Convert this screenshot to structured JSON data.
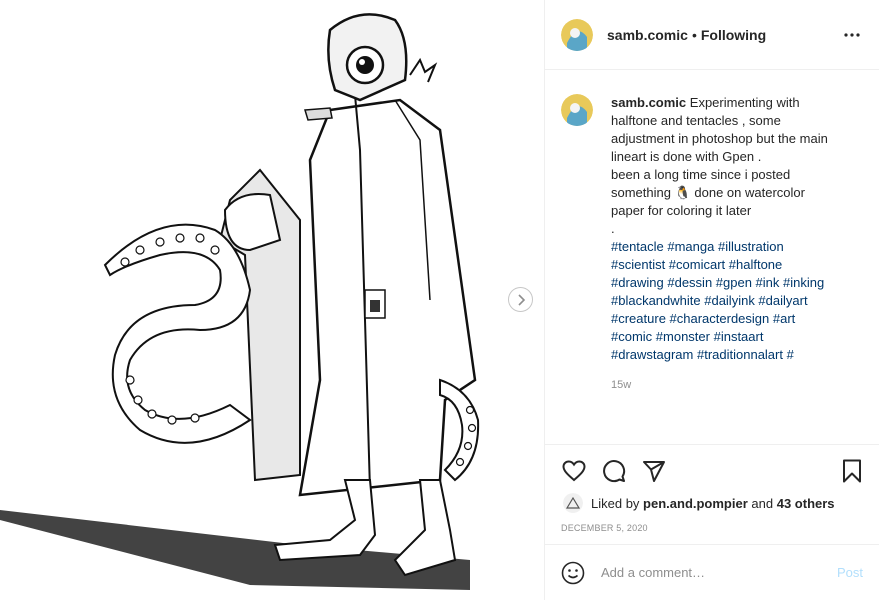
{
  "post": {
    "username": "samb.comic",
    "separator": "•",
    "follow_status": "Following",
    "caption_lines": [
      "Experimenting with",
      "halftone and tentacles , some",
      "adjustment in photoshop but the main",
      "lineart is done with Gpen .",
      "been a long time since i posted",
      "something 🐧 done on watercolor",
      "paper for coloring it later",
      "."
    ],
    "hashtags": [
      "#tentacle #manga #illustration",
      "#scientist #comicart #halftone",
      "#drawing #dessin #gpen #ink #inking",
      "#blackandwhite #dailyink #dailyart",
      "#creature #characterdesign #art",
      "#comic #monster #instaart",
      "#drawstagram #traditionnalart #"
    ],
    "age": "15w",
    "liked_by_prefix": "Liked by",
    "liked_by_user": "pen.and.pompier",
    "liked_by_and": "and",
    "liked_by_others": "43 others",
    "date": "DECEMBER 5, 2020",
    "comment_placeholder": "Add a comment…",
    "post_label": "Post"
  },
  "icons": {
    "more": "more-options-icon",
    "like": "heart-icon",
    "comment": "comment-icon",
    "share": "share-icon",
    "save": "bookmark-icon",
    "emoji": "emoji-icon",
    "next": "chevron-right-icon"
  },
  "colors": {
    "text": "#262626",
    "hashtag": "#00376b",
    "muted": "#8e8e8e",
    "post_disabled": "#b2dffc",
    "border": "#efefef"
  }
}
